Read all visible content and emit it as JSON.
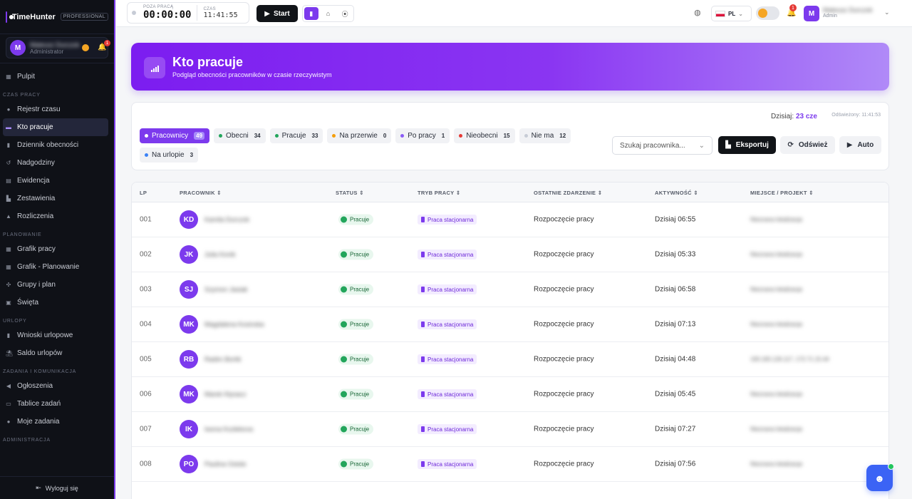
{
  "brand": {
    "name": "TimeHunter",
    "badge": "PROFESSIONAL"
  },
  "sidebar_user": {
    "initial": "M",
    "name": "Mateusz Durczok",
    "role": "Administrator",
    "notifications": "1"
  },
  "nav": {
    "pulpit": "Pulpit",
    "sections": {
      "czas": "CZAS PRACY",
      "planowanie": "PLANOWANIE",
      "urlopy": "URLOPY",
      "zadania": "ZADANIA I KOMUNIKACJA",
      "administracja": "ADMINISTRACJA"
    },
    "czas_items": [
      "Rejestr czasu",
      "Kto pracuje",
      "Dziennik obecności",
      "Nadgodziny",
      "Ewidencja",
      "Zestawienia",
      "Rozliczenia"
    ],
    "planowanie_items": [
      "Grafik pracy",
      "Grafik - Planowanie",
      "Grupy i plan",
      "Święta"
    ],
    "urlopy_items": [
      "Wnioski urlopowe",
      "Saldo urlopów"
    ],
    "zadania_items": [
      "Ogłoszenia",
      "Tablice zadań",
      "Moje zadania"
    ],
    "logout": "Wyloguj się"
  },
  "topbar": {
    "timer_label": "POZA PRACĄ",
    "timer_value": "00:00:00",
    "clock_label": "CZAS",
    "clock_value": "11:41:55",
    "start": "Start",
    "lang": "PL",
    "notifications": "1",
    "user_initial": "M",
    "user_name": "Mateusz Durczok",
    "user_role": "Admin"
  },
  "banner": {
    "title": "Kto pracuje",
    "subtitle": "Podgląd obecności pracowników w czasie rzeczywistym"
  },
  "filters": {
    "today_label": "Dzisiaj:",
    "today_value": "23 cze",
    "refreshed": "Odświeżony: 11:41:53",
    "chips": [
      {
        "label": "Pracownicy",
        "count": "49",
        "color": "#ffffff"
      },
      {
        "label": "Obecni",
        "count": "34",
        "color": "#22a55b"
      },
      {
        "label": "Pracuje",
        "count": "33",
        "color": "#22a55b"
      },
      {
        "label": "Na przerwie",
        "count": "0",
        "color": "#f59e0b"
      },
      {
        "label": "Po pracy",
        "count": "1",
        "color": "#8b5cf6"
      },
      {
        "label": "Nieobecni",
        "count": "15",
        "color": "#e53935"
      },
      {
        "label": "Nie ma",
        "count": "12",
        "color": "#c7ccd6"
      },
      {
        "label": "Na urlopie",
        "count": "3",
        "color": "#3b82f6"
      }
    ],
    "search_placeholder": "Szukaj pracownika...",
    "export": "Eksportuj",
    "refresh": "Odśwież",
    "auto": "Auto"
  },
  "table": {
    "headers": {
      "lp": "LP",
      "employee": "PRACOWNIK",
      "status": "STATUS",
      "mode": "TRYB PRACY",
      "event": "OSTATNIE ZDARZENIE",
      "activity": "AKTYWNOŚĆ",
      "place": "MIEJSCE / PROJEKT"
    },
    "rows": [
      {
        "lp": "001",
        "initials": "KD",
        "name": "Kamila Durczok",
        "status": "Pracuje",
        "mode": "Praca stacjonarna",
        "event": "Rozpoczęcie pracy",
        "activity": "Dzisiaj 06:55",
        "place": "Nieznana lokalizacja"
      },
      {
        "lp": "002",
        "initials": "JK",
        "name": "Julia Konik",
        "status": "Pracuje",
        "mode": "Praca stacjonarna",
        "event": "Rozpoczęcie pracy",
        "activity": "Dzisiaj 05:33",
        "place": "Nieznana lokalizacja"
      },
      {
        "lp": "003",
        "initials": "SJ",
        "name": "Szymon Jasiak",
        "status": "Pracuje",
        "mode": "Praca stacjonarna",
        "event": "Rozpoczęcie pracy",
        "activity": "Dzisiaj 06:58",
        "place": "Nieznana lokalizacja"
      },
      {
        "lp": "004",
        "initials": "MK",
        "name": "Magdalena Kosinska",
        "status": "Pracuje",
        "mode": "Praca stacjonarna",
        "event": "Rozpoczęcie pracy",
        "activity": "Dzisiaj 07:13",
        "place": "Nieznana lokalizacja"
      },
      {
        "lp": "005",
        "initials": "RB",
        "name": "Radim Bortik",
        "status": "Pracuje",
        "mode": "Praca stacjonarna",
        "event": "Rozpoczęcie pracy",
        "activity": "Dzisiaj 04:48",
        "place": "193.165.126.117, 172.71.15.44"
      },
      {
        "lp": "006",
        "initials": "MK",
        "name": "Marek Kłysacz",
        "status": "Pracuje",
        "mode": "Praca stacjonarna",
        "event": "Rozpoczęcie pracy",
        "activity": "Dzisiaj 05:45",
        "place": "Nieznana lokalizacja"
      },
      {
        "lp": "007",
        "initials": "IK",
        "name": "Iwona Kozłekova",
        "status": "Pracuje",
        "mode": "Praca stacjonarna",
        "event": "Rozpoczęcie pracy",
        "activity": "Dzisiaj 07:27",
        "place": "Nieznana lokalizacja"
      },
      {
        "lp": "008",
        "initials": "PO",
        "name": "Paulina Ostoło",
        "status": "Pracuje",
        "mode": "Praca stacjonarna",
        "event": "Rozpoczęcie pracy",
        "activity": "Dzisiaj 07:56",
        "place": "Nieznana lokalizacja"
      }
    ]
  },
  "colors": {
    "accent": "#7c3aed",
    "status_green": "#22a55b",
    "sidebar_bg": "#0f1117"
  }
}
